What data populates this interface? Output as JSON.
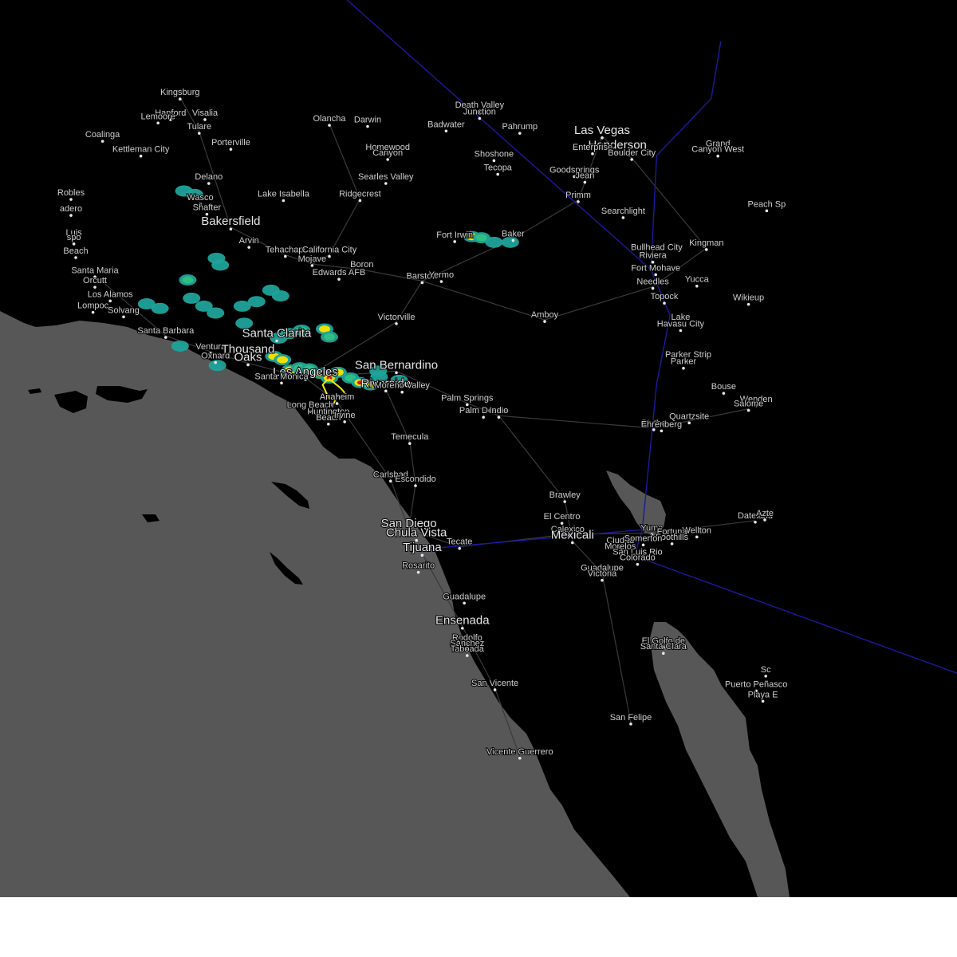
{
  "colors": {
    "ocean": "#575757",
    "land": "#000000",
    "road": "#3a3a3a",
    "border": "#1a1aa0",
    "warning_outline": "#f2e900",
    "radar_light": "#1fa39a",
    "radar_mid": "#2fbf80",
    "radar_yellow": "#f0e000",
    "radar_orange": "#f08a00",
    "radar_red": "#d21c1c"
  },
  "labels": [
    {
      "text": "Kingsburg",
      "lon": -119.55,
      "lat": 36.51,
      "major": false
    },
    {
      "text": "Hanford",
      "lon": -119.65,
      "lat": 36.33,
      "major": false
    },
    {
      "text": "Visalia",
      "lon": -119.29,
      "lat": 36.33,
      "major": false
    },
    {
      "text": "Lemoore",
      "lon": -119.78,
      "lat": 36.3,
      "major": false
    },
    {
      "text": "Tulare",
      "lon": -119.35,
      "lat": 36.21,
      "major": false
    },
    {
      "text": "Coalinga",
      "lon": -120.36,
      "lat": 36.14,
      "major": false
    },
    {
      "text": "Porterville",
      "lon": -119.02,
      "lat": 36.07,
      "major": false
    },
    {
      "text": "Kettleman City",
      "lon": -119.96,
      "lat": 36.01,
      "major": false
    },
    {
      "text": "Delano",
      "lon": -119.25,
      "lat": 35.77,
      "major": false
    },
    {
      "text": "Robles",
      "lon": -120.69,
      "lat": 35.63,
      "major": false
    },
    {
      "text": "Wasco",
      "lon": -119.34,
      "lat": 35.59,
      "major": false
    },
    {
      "text": "Shafter",
      "lon": -119.27,
      "lat": 35.5,
      "major": false
    },
    {
      "text": "adero",
      "lon": -120.69,
      "lat": 35.49,
      "major": false
    },
    {
      "text": "Bakersfield",
      "lon": -119.02,
      "lat": 35.37,
      "major": true
    },
    {
      "text": "Luis",
      "lon": -120.66,
      "lat": 35.28,
      "major": false
    },
    {
      "text": "spo",
      "lon": -120.66,
      "lat": 35.24,
      "major": false
    },
    {
      "text": "Arvin",
      "lon": -118.83,
      "lat": 35.21,
      "major": false
    },
    {
      "text": "Tehachapi",
      "lon": -118.45,
      "lat": 35.13,
      "major": false
    },
    {
      "text": "Beach",
      "lon": -120.64,
      "lat": 35.12,
      "major": false
    },
    {
      "text": "Santa Maria",
      "lon": -120.44,
      "lat": 34.95,
      "major": false
    },
    {
      "text": "Orcutt",
      "lon": -120.44,
      "lat": 34.86,
      "major": false
    },
    {
      "text": "Los Alamos",
      "lon": -120.28,
      "lat": 34.74,
      "major": false
    },
    {
      "text": "Lompoc",
      "lon": -120.46,
      "lat": 34.64,
      "major": false
    },
    {
      "text": "Solvang",
      "lon": -120.14,
      "lat": 34.6,
      "major": false
    },
    {
      "text": "Santa Barbara",
      "lon": -119.7,
      "lat": 34.42,
      "major": false
    },
    {
      "text": "Ventura",
      "lon": -119.23,
      "lat": 34.28,
      "major": false
    },
    {
      "text": "Oxnard",
      "lon": -119.18,
      "lat": 34.2,
      "major": false
    },
    {
      "text": "Thousand",
      "lon": -118.84,
      "lat": 34.25,
      "major": true
    },
    {
      "text": "Oaks",
      "lon": -118.84,
      "lat": 34.18,
      "major": true
    },
    {
      "text": "Santa Clarita",
      "lon": -118.54,
      "lat": 34.39,
      "major": true
    },
    {
      "text": "Los Angeles",
      "lon": -118.24,
      "lat": 34.05,
      "major": true
    },
    {
      "text": "Santa Monica",
      "lon": -118.49,
      "lat": 34.02,
      "major": false
    },
    {
      "text": "Long Beach",
      "lon": -118.19,
      "lat": 33.77,
      "major": false
    },
    {
      "text": "Huntington",
      "lon": -118.0,
      "lat": 33.71,
      "major": false
    },
    {
      "text": "Beach",
      "lon": -118.0,
      "lat": 33.66,
      "major": false
    },
    {
      "text": "Anaheim",
      "lon": -117.91,
      "lat": 33.84,
      "major": false
    },
    {
      "text": "Irvine",
      "lon": -117.83,
      "lat": 33.68,
      "major": false
    },
    {
      "text": "California City",
      "lon": -117.99,
      "lat": 35.13,
      "major": false
    },
    {
      "text": "Mojave",
      "lon": -118.17,
      "lat": 35.05,
      "major": false
    },
    {
      "text": "Boron",
      "lon": -117.65,
      "lat": 35.0,
      "major": false
    },
    {
      "text": "Edwards AFB",
      "lon": -117.89,
      "lat": 34.93,
      "major": false
    },
    {
      "text": "Lake Isabella",
      "lon": -118.47,
      "lat": 35.62,
      "major": false
    },
    {
      "text": "Ridgecrest",
      "lon": -117.67,
      "lat": 35.62,
      "major": false
    },
    {
      "text": "Olancha",
      "lon": -117.99,
      "lat": 36.28,
      "major": false
    },
    {
      "text": "Darwin",
      "lon": -117.59,
      "lat": 36.27,
      "major": false
    },
    {
      "text": "Homewood",
      "lon": -117.38,
      "lat": 36.03,
      "major": false
    },
    {
      "text": "Canyon",
      "lon": -117.38,
      "lat": 35.98,
      "major": false
    },
    {
      "text": "Searles Valley",
      "lon": -117.4,
      "lat": 35.77,
      "major": false
    },
    {
      "text": "Badwater",
      "lon": -116.77,
      "lat": 36.23,
      "major": false
    },
    {
      "text": "Death Valley",
      "lon": -116.42,
      "lat": 36.4,
      "major": false
    },
    {
      "text": "Junction",
      "lon": -116.42,
      "lat": 36.34,
      "major": false
    },
    {
      "text": "Pahrump",
      "lon": -116.0,
      "lat": 36.21,
      "major": false
    },
    {
      "text": "Shoshone",
      "lon": -116.27,
      "lat": 35.97,
      "major": false
    },
    {
      "text": "Tecopa",
      "lon": -116.23,
      "lat": 35.85,
      "major": false
    },
    {
      "text": "Las Vegas",
      "lon": -115.14,
      "lat": 36.17,
      "major": true
    },
    {
      "text": "Henderson",
      "lon": -114.98,
      "lat": 36.04,
      "major": true
    },
    {
      "text": "Enterprise",
      "lon": -115.24,
      "lat": 36.03,
      "major": false
    },
    {
      "text": "Boulder City",
      "lon": -114.83,
      "lat": 35.98,
      "major": false
    },
    {
      "text": "Grand",
      "lon": -113.93,
      "lat": 36.06,
      "major": false
    },
    {
      "text": "Canyon West",
      "lon": -113.93,
      "lat": 36.01,
      "major": false
    },
    {
      "text": "Goodsprings",
      "lon": -115.43,
      "lat": 35.83,
      "major": false
    },
    {
      "text": "Jean",
      "lon": -115.32,
      "lat": 35.78,
      "major": false
    },
    {
      "text": "Primm",
      "lon": -115.39,
      "lat": 35.61,
      "major": false
    },
    {
      "text": "Searchlight",
      "lon": -114.92,
      "lat": 35.47,
      "major": false
    },
    {
      "text": "Peach Sp",
      "lon": -113.42,
      "lat": 35.53,
      "major": false
    },
    {
      "text": "Fort Irwin",
      "lon": -116.68,
      "lat": 35.26,
      "major": false
    },
    {
      "text": "Baker",
      "lon": -116.07,
      "lat": 35.27,
      "major": false
    },
    {
      "text": "Bullhead City",
      "lon": -114.57,
      "lat": 35.15,
      "major": false
    },
    {
      "text": "Riviera",
      "lon": -114.61,
      "lat": 35.08,
      "major": false
    },
    {
      "text": "Kingman",
      "lon": -114.05,
      "lat": 35.19,
      "major": false
    },
    {
      "text": "Fort Mohave",
      "lon": -114.58,
      "lat": 34.97,
      "major": false
    },
    {
      "text": "Needles",
      "lon": -114.61,
      "lat": 34.85,
      "major": false
    },
    {
      "text": "Yucca",
      "lon": -114.15,
      "lat": 34.87,
      "major": false
    },
    {
      "text": "Topock",
      "lon": -114.49,
      "lat": 34.72,
      "major": false
    },
    {
      "text": "Wikieup",
      "lon": -113.61,
      "lat": 34.71,
      "major": false
    },
    {
      "text": "Barstow",
      "lon": -117.02,
      "lat": 34.9,
      "major": false
    },
    {
      "text": "Yermo",
      "lon": -116.82,
      "lat": 34.91,
      "major": false
    },
    {
      "text": "Amboy",
      "lon": -115.74,
      "lat": 34.56,
      "major": false
    },
    {
      "text": "Lake",
      "lon": -114.32,
      "lat": 34.54,
      "major": false
    },
    {
      "text": "Havasu City",
      "lon": -114.32,
      "lat": 34.48,
      "major": false
    },
    {
      "text": "Victorville",
      "lon": -117.29,
      "lat": 34.54,
      "major": false
    },
    {
      "text": "San Bernardino",
      "lon": -117.29,
      "lat": 34.11,
      "major": true
    },
    {
      "text": "Riverside",
      "lon": -117.4,
      "lat": 33.95,
      "major": true
    },
    {
      "text": "Moreno Valley",
      "lon": -117.23,
      "lat": 33.94,
      "major": false
    },
    {
      "text": "Palm Springs",
      "lon": -116.55,
      "lat": 33.83,
      "major": false
    },
    {
      "text": "Palm Desert",
      "lon": -116.38,
      "lat": 33.72,
      "major": false
    },
    {
      "text": "Indio",
      "lon": -116.22,
      "lat": 33.72,
      "major": false
    },
    {
      "text": "Parker Strip",
      "lon": -114.24,
      "lat": 34.21,
      "major": false
    },
    {
      "text": "Parker",
      "lon": -114.29,
      "lat": 34.15,
      "major": false
    },
    {
      "text": "Bouse",
      "lon": -113.87,
      "lat": 33.93,
      "major": false
    },
    {
      "text": "Wenden",
      "lon": -113.53,
      "lat": 33.82,
      "major": false
    },
    {
      "text": "Salome",
      "lon": -113.61,
      "lat": 33.78,
      "major": false
    },
    {
      "text": "Quartzsite",
      "lon": -114.23,
      "lat": 33.67,
      "major": false
    },
    {
      "text": "Blythe",
      "lon": -114.6,
      "lat": 33.61,
      "major": false
    },
    {
      "text": "Ehrenberg",
      "lon": -114.52,
      "lat": 33.6,
      "major": false
    },
    {
      "text": "Temecula",
      "lon": -117.15,
      "lat": 33.49,
      "major": false
    },
    {
      "text": "Carlsbad",
      "lon": -117.35,
      "lat": 33.16,
      "major": false
    },
    {
      "text": "Escondido",
      "lon": -117.09,
      "lat": 33.12,
      "major": false
    },
    {
      "text": "Brawley",
      "lon": -115.53,
      "lat": 32.98,
      "major": false
    },
    {
      "text": "El Centro",
      "lon": -115.56,
      "lat": 32.79,
      "major": false
    },
    {
      "text": "Calexico",
      "lon": -115.5,
      "lat": 32.68,
      "major": false
    },
    {
      "text": "Mexicali",
      "lon": -115.45,
      "lat": 32.62,
      "major": true
    },
    {
      "text": "San Diego",
      "lon": -117.16,
      "lat": 32.72,
      "major": true
    },
    {
      "text": "Chula Vista",
      "lon": -117.08,
      "lat": 32.64,
      "major": true
    },
    {
      "text": "Tijuana",
      "lon": -117.02,
      "lat": 32.51,
      "major": true
    },
    {
      "text": "Tecate",
      "lon": -116.63,
      "lat": 32.57,
      "major": false
    },
    {
      "text": "Rosarito",
      "lon": -117.06,
      "lat": 32.36,
      "major": false
    },
    {
      "text": "Yuma",
      "lon": -114.62,
      "lat": 32.69,
      "major": false
    },
    {
      "text": "Wellton",
      "lon": -114.15,
      "lat": 32.67,
      "major": false
    },
    {
      "text": "Dateland",
      "lon": -113.54,
      "lat": 32.8,
      "major": false
    },
    {
      "text": "Azte",
      "lon": -113.44,
      "lat": 32.82,
      "major": false
    },
    {
      "text": "Ciudad",
      "lon": -114.95,
      "lat": 32.58,
      "major": false
    },
    {
      "text": "Morelos",
      "lon": -114.95,
      "lat": 32.53,
      "major": false
    },
    {
      "text": "Fortuna",
      "lon": -114.41,
      "lat": 32.66,
      "major": false
    },
    {
      "text": "Foothills",
      "lon": -114.41,
      "lat": 32.61,
      "major": false
    },
    {
      "text": "Somerton",
      "lon": -114.71,
      "lat": 32.6,
      "major": false
    },
    {
      "text": "San Luis Rio",
      "lon": -114.77,
      "lat": 32.48,
      "major": false
    },
    {
      "text": "Colorado",
      "lon": -114.77,
      "lat": 32.43,
      "major": false
    },
    {
      "text": "Guadalupe",
      "lon": -115.14,
      "lat": 32.34,
      "major": false
    },
    {
      "text": "Victoria",
      "lon": -115.14,
      "lat": 32.29,
      "major": false
    },
    {
      "text": "Guadalupe",
      "lon": -116.58,
      "lat": 32.09,
      "major": false
    },
    {
      "text": "Ensenada",
      "lon": -116.6,
      "lat": 31.87,
      "major": true
    },
    {
      "text": "Rodolfo",
      "lon": -116.55,
      "lat": 31.73,
      "major": false
    },
    {
      "text": "Sánchez",
      "lon": -116.55,
      "lat": 31.68,
      "major": false
    },
    {
      "text": "Taboada",
      "lon": -116.55,
      "lat": 31.63,
      "major": false
    },
    {
      "text": "El Golfo de",
      "lon": -114.5,
      "lat": 31.7,
      "major": false
    },
    {
      "text": "Santa Clara",
      "lon": -114.5,
      "lat": 31.65,
      "major": false
    },
    {
      "text": "San Vicente",
      "lon": -116.26,
      "lat": 31.33,
      "major": false
    },
    {
      "text": "Puerto Peñasco",
      "lon": -113.53,
      "lat": 31.32,
      "major": false
    },
    {
      "text": "Playa E",
      "lon": -113.46,
      "lat": 31.23,
      "major": false
    },
    {
      "text": "San Felipe",
      "lon": -114.84,
      "lat": 31.03,
      "major": false
    },
    {
      "text": "Vicente Guerrero",
      "lon": -116.0,
      "lat": 30.73,
      "major": false
    },
    {
      "text": "Sc",
      "lon": -113.43,
      "lat": 31.45,
      "major": false
    }
  ],
  "radar_cells": [
    {
      "lon": -119.51,
      "lat": 35.69,
      "level": 1
    },
    {
      "lon": -119.4,
      "lat": 35.66,
      "level": 1
    },
    {
      "lon": -119.17,
      "lat": 35.1,
      "level": 1
    },
    {
      "lon": -119.13,
      "lat": 35.04,
      "level": 1
    },
    {
      "lon": -119.47,
      "lat": 34.91,
      "level": 2
    },
    {
      "lon": -119.9,
      "lat": 34.7,
      "level": 1
    },
    {
      "lon": -119.76,
      "lat": 34.66,
      "level": 1
    },
    {
      "lon": -119.43,
      "lat": 34.75,
      "level": 1
    },
    {
      "lon": -119.3,
      "lat": 34.68,
      "level": 1
    },
    {
      "lon": -119.18,
      "lat": 34.62,
      "level": 1
    },
    {
      "lon": -118.9,
      "lat": 34.68,
      "level": 1
    },
    {
      "lon": -118.75,
      "lat": 34.72,
      "level": 1
    },
    {
      "lon": -118.6,
      "lat": 34.82,
      "level": 1
    },
    {
      "lon": -118.5,
      "lat": 34.77,
      "level": 1
    },
    {
      "lon": -118.88,
      "lat": 34.53,
      "level": 1
    },
    {
      "lon": -119.55,
      "lat": 34.33,
      "level": 1
    },
    {
      "lon": -119.16,
      "lat": 34.16,
      "level": 1
    },
    {
      "lon": -118.52,
      "lat": 34.4,
      "level": 1
    },
    {
      "lon": -118.41,
      "lat": 34.44,
      "level": 2
    },
    {
      "lon": -118.28,
      "lat": 34.47,
      "level": 2
    },
    {
      "lon": -118.04,
      "lat": 34.48,
      "level": 3
    },
    {
      "lon": -117.99,
      "lat": 34.41,
      "level": 2
    },
    {
      "lon": -118.57,
      "lat": 34.24,
      "level": 3
    },
    {
      "lon": -118.48,
      "lat": 34.21,
      "level": 3
    },
    {
      "lon": -118.4,
      "lat": 34.12,
      "level": 4
    },
    {
      "lon": -118.3,
      "lat": 34.14,
      "level": 2
    },
    {
      "lon": -118.2,
      "lat": 34.13,
      "level": 2
    },
    {
      "lon": -118.08,
      "lat": 34.09,
      "level": 3
    },
    {
      "lon": -117.99,
      "lat": 34.05,
      "level": 4
    },
    {
      "lon": -117.9,
      "lat": 34.1,
      "level": 3
    },
    {
      "lon": -117.77,
      "lat": 34.05,
      "level": 2
    },
    {
      "lon": -117.67,
      "lat": 34.01,
      "level": 4
    },
    {
      "lon": -117.56,
      "lat": 33.99,
      "level": 3
    },
    {
      "lon": -117.47,
      "lat": 34.06,
      "level": 1
    },
    {
      "lon": -117.48,
      "lat": 34.11,
      "level": 1
    },
    {
      "lon": -117.26,
      "lat": 34.03,
      "level": 1
    },
    {
      "lon": -116.5,
      "lat": 35.29,
      "level": 3
    },
    {
      "lon": -116.4,
      "lat": 35.28,
      "level": 2
    },
    {
      "lon": -116.27,
      "lat": 35.24,
      "level": 1
    },
    {
      "lon": -116.1,
      "lat": 35.24,
      "level": 1
    }
  ],
  "warning_polygon": [
    [
      -118.03,
      34.02
    ],
    [
      -117.99,
      34.04
    ],
    [
      -117.87,
      33.96
    ],
    [
      -117.81,
      33.9
    ],
    [
      -117.85,
      33.89
    ],
    [
      -117.91,
      33.89
    ],
    [
      -117.96,
      33.8
    ],
    [
      -118.0,
      33.88
    ],
    [
      -118.06,
      33.99
    ]
  ]
}
